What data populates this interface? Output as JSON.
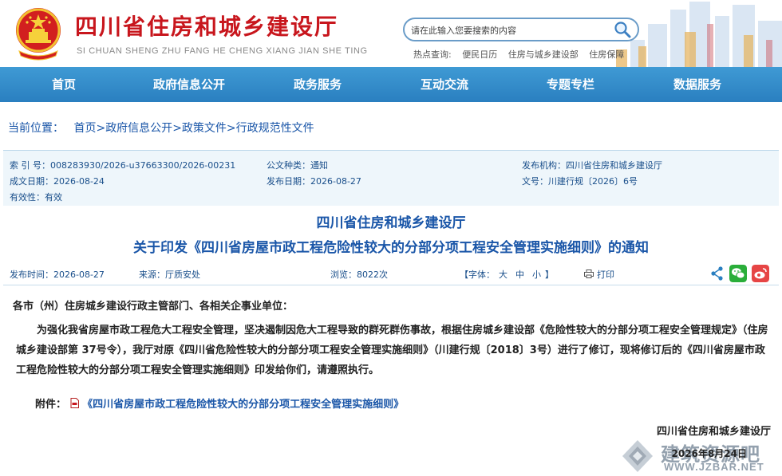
{
  "header": {
    "site_title": "四川省住房和城乡建设厅",
    "site_pinyin": "SI CHUAN SHENG ZHU FANG HE CHENG XIANG JIAN SHE TING",
    "search_placeholder": "请在此输入您要搜索的内容",
    "hotwords": [
      "热点查询:",
      "便民日历",
      "住房与城乡建设部",
      "住房保障"
    ]
  },
  "nav": {
    "items": [
      "首页",
      "政府信息公开",
      "政务服务",
      "互动交流",
      "专题专栏",
      "数据服务"
    ]
  },
  "breadcrumb": {
    "label": "当前位置：",
    "items": [
      "首页",
      "政府信息公开",
      "政策文件",
      "行政规范性文件"
    ],
    "sep": ">"
  },
  "meta": {
    "index_key": "索 引 号：",
    "index_val": "008283930/2026-u37663300/2026-00231",
    "type_key": "公文种类：",
    "type_val": "通知",
    "org_key": "发布机构：",
    "org_val": "四川省住房和城乡建设厅",
    "created_key": "成文日期：",
    "created_val": "2026-08-24",
    "pub_key": "发布日期：",
    "pub_val": "2026-08-27",
    "docno_key": "文号：",
    "docno_val": "川建行规〔2026〕6号",
    "valid_key": "有效性：",
    "valid_val": "有效"
  },
  "title": {
    "line1": "四川省住房和城乡建设厅",
    "line2": "关于印发《四川省房屋市政工程危险性较大的分部分项工程安全管理实施细则》的通知"
  },
  "info": {
    "time_key": "发布时间：",
    "time_val": "2026-08-27",
    "source_key": "来源：",
    "source_val": "厅质安处",
    "views_key": "浏览：",
    "views_val": "8022次",
    "font_key": "【字体：",
    "font_big": "大",
    "font_mid": "中",
    "font_small": "小",
    "font_end": "】",
    "print": "打印"
  },
  "content": {
    "greeting": "各市（州）住房城乡建设行政主管部门、各相关企事业单位：",
    "paragraph": "为强化我省房屋市政工程危大工程安全管理，坚决遏制因危大工程导致的群死群伤事故，根据住房城乡建设部《危险性较大的分部分项工程安全管理规定》（住房城乡建设部第 37号令），我厅对原《四川省危险性较大的分部分项工程安全管理实施细则》（川建行规〔2018〕3号）进行了修订，现将修订后的《四川省房屋市政工程危险性较大的分部分项工程安全管理实施细则》印发给你们，请遵照执行。",
    "attach_label": "附件：",
    "attach_link": "《四川省房屋市政工程危险性较大的分部分项工程安全管理实施细则》",
    "signature": "四川省住房和城乡建设厅",
    "date": "2026年8月24日"
  },
  "watermark": {
    "text": "建筑资源吧",
    "url": "WWW.JZBAR.NET"
  },
  "colors": {
    "brand_red": "#c8161d",
    "nav_blue": "#2a7fc0",
    "link_blue": "#1a56a8"
  }
}
